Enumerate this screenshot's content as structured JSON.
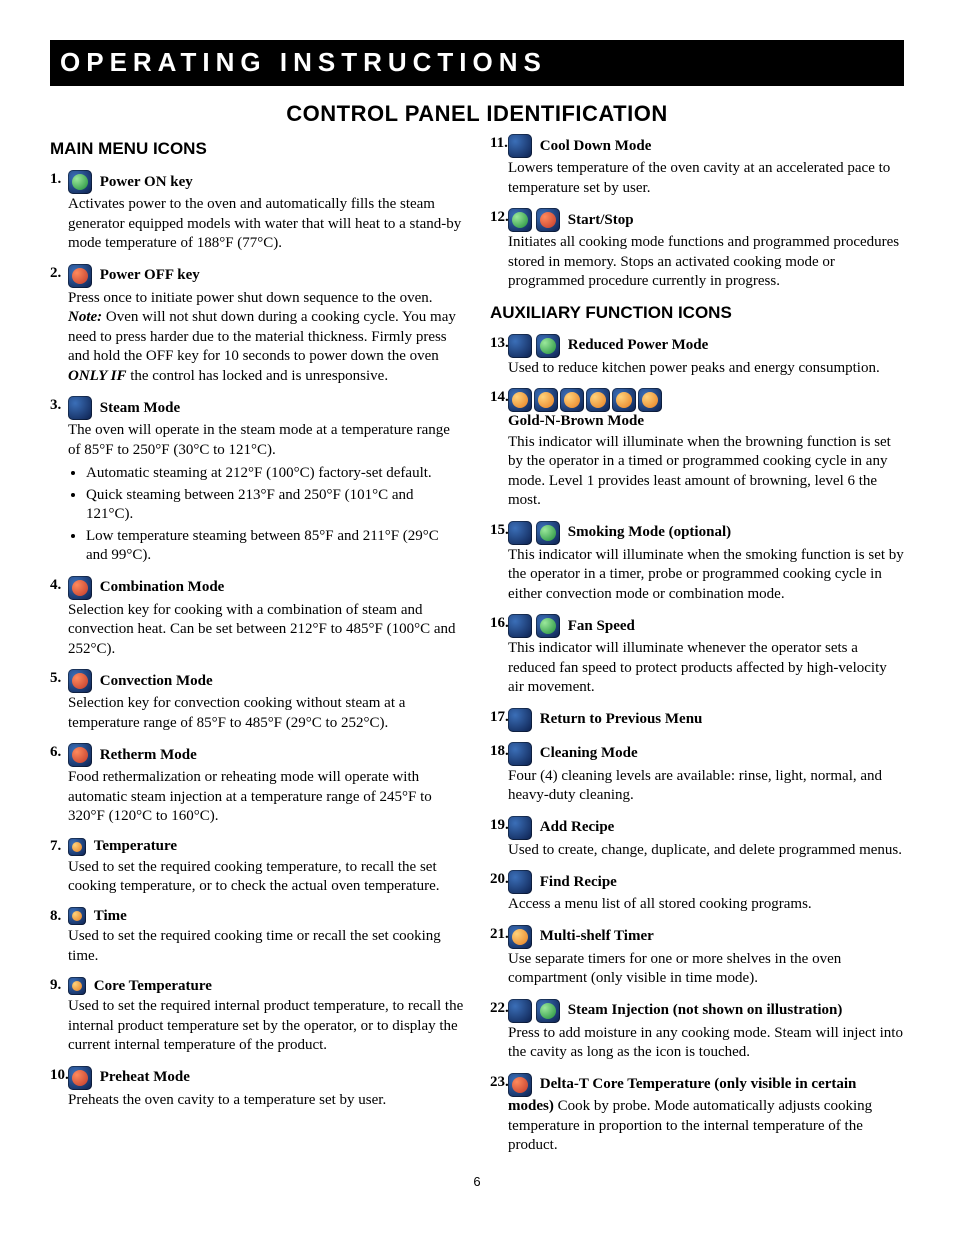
{
  "banner": "OPERATING INSTRUCTIONS",
  "section_title": "CONTROL PANEL IDENTIFICATION",
  "page_number": "6",
  "left": {
    "heading": "MAIN MENU ICONS",
    "items": [
      {
        "num": "1.",
        "icon": "power-on-icon",
        "label": "Power ON key",
        "body": "Activates power to the oven and automatically fills the steam generator equipped models with water that will heat to a stand-by mode temperature of 188°F (77°C)."
      },
      {
        "num": "2.",
        "icon": "power-off-icon",
        "label": "Power OFF key",
        "body_parts": [
          {
            "t": "p",
            "v": "Press once to initiate power shut down sequence to the oven.  "
          },
          {
            "t": "note",
            "v": "Note:"
          },
          {
            "t": "p",
            "v": " Oven will not shut down during a cooking cycle. You may need to press harder due to the material thickness. Firmly press and hold the OFF key for 10 seconds to power down the oven "
          },
          {
            "t": "bi",
            "v": "ONLY IF"
          },
          {
            "t": "p",
            "v": " the control has locked and is unresponsive."
          }
        ]
      },
      {
        "num": "3.",
        "icon": "steam-mode-icon",
        "label": "Steam Mode",
        "body": "The oven will operate in the steam mode at a temperature range of 85°F to 250°F (30°C to 121°C).",
        "bullets": [
          "Automatic steaming at 212°F (100°C) factory-set default.",
          "Quick steaming between 213°F and 250°F (101°C and 121°C).",
          "Low temperature steaming between 85°F and 211°F (29°C and 99°C)."
        ]
      },
      {
        "num": "4.",
        "icon": "combination-mode-icon",
        "label": "Combination Mode",
        "body": "Selection key for cooking with a combination of steam and convection heat. Can be set between 212°F to 485°F (100°C and 252°C)."
      },
      {
        "num": "5.",
        "icon": "convection-mode-icon",
        "label": "Convection Mode",
        "body": "Selection key for convection cooking without steam at a temperature range of 85°F to 485°F (29°C to 252°C)."
      },
      {
        "num": "6.",
        "icon": "retherm-mode-icon",
        "label": "Retherm Mode",
        "body": "Food rethermalization or reheating mode will operate with automatic steam injection at a temperature range of 245°F to 320°F (120°C to 160°C)."
      },
      {
        "num": "7.",
        "icon": "temperature-icon",
        "small": true,
        "label": "Temperature",
        "body": "Used to set the required cooking temperature, to recall the set cooking temperature, or to check the actual oven temperature."
      },
      {
        "num": "8.",
        "icon": "time-icon",
        "small": true,
        "label": "Time",
        "body": "Used to set the required cooking time or recall the set cooking time."
      },
      {
        "num": "9.",
        "icon": "core-temperature-icon",
        "small": true,
        "label": "Core Temperature",
        "body": "Used to set the required internal product temperature, to recall the internal product temperature set by the operator, or to display the current internal temperature of the product."
      },
      {
        "num": "10.",
        "icon": "preheat-mode-icon",
        "label": "Preheat Mode",
        "body": "Preheats the oven cavity to a temperature set by user."
      }
    ]
  },
  "right": {
    "heading": "AUXILIARY FUNCTION ICONS",
    "top_items": [
      {
        "num": "11.",
        "icon": "cool-down-mode-icon",
        "label": "Cool Down Mode",
        "body": "Lowers temperature of the oven cavity at an accelerated pace to temperature set by user."
      },
      {
        "num": "12.",
        "icons": [
          "start-icon",
          "stop-icon"
        ],
        "label": "Start/Stop",
        "body": "Initiates all cooking mode functions and programmed procedures stored in memory. Stops an activated cooking mode or programmed procedure currently in progress."
      }
    ],
    "items": [
      {
        "num": "13.",
        "icons": [
          "reduced-power-icon-a",
          "reduced-power-icon-b"
        ],
        "label": "Reduced Power Mode",
        "body": "Used to reduce kitchen power peaks and energy consumption."
      },
      {
        "num": "14.",
        "icon_row": [
          "gold-n-brown-level-1-icon",
          "gold-n-brown-level-2-icon",
          "gold-n-brown-level-3-icon",
          "gold-n-brown-level-4-icon",
          "gold-n-brown-level-5-icon",
          "gold-n-brown-level-6-icon"
        ],
        "label": "Gold-N-Brown Mode",
        "body": "This indicator will illuminate when the browning function is set by the operator in a timed or programmed cooking cycle in any mode. Level 1 provides least amount of browning, level 6 the most."
      },
      {
        "num": "15.",
        "icons": [
          "smoking-mode-icon-a",
          "smoking-mode-icon-b"
        ],
        "label": "Smoking Mode (optional)",
        "body": "This indicator will illuminate when the smoking function is set by the operator in a timer, probe or programmed cooking cycle in either convection mode or combination mode."
      },
      {
        "num": "16.",
        "icons": [
          "fan-speed-icon-a",
          "fan-speed-icon-b"
        ],
        "label": "Fan Speed",
        "body": "This indicator will illuminate whenever the operator sets a reduced fan speed to protect products affected by high-velocity air movement."
      },
      {
        "num": "17.",
        "icon": "return-icon",
        "label": "Return to Previous Menu"
      },
      {
        "num": "18.",
        "icon": "cleaning-mode-icon",
        "label": "Cleaning Mode",
        "body": "Four (4) cleaning levels are available: rinse, light, normal, and heavy-duty cleaning."
      },
      {
        "num": "19.",
        "icon": "add-recipe-icon",
        "label": "Add Recipe",
        "body": "Used to create, change, duplicate, and delete programmed menus."
      },
      {
        "num": "20.",
        "icon": "find-recipe-icon",
        "label": "Find Recipe",
        "body": "Access a menu list of all stored cooking programs."
      },
      {
        "num": "21.",
        "icon": "multi-shelf-timer-icon",
        "label": "Multi-shelf Timer",
        "body": "Use separate timers for one or more shelves in the oven compartment (only visible in time mode)."
      },
      {
        "num": "22.",
        "icons": [
          "steam-injection-icon-a",
          "steam-injection-icon-b"
        ],
        "label": "Steam Injection (not shown on illustration)",
        "body": "Press to add moisture in any cooking mode. Steam will inject into the cavity as long as the icon is touched."
      },
      {
        "num": "23.",
        "icon": "delta-t-icon",
        "label": "Delta-T Core Temperature (only visible in certain modes)",
        "body": " Cook by probe. Mode automatically adjusts cooking temperature in proportion to the internal temperature of the product.",
        "inline_body": true
      }
    ]
  }
}
